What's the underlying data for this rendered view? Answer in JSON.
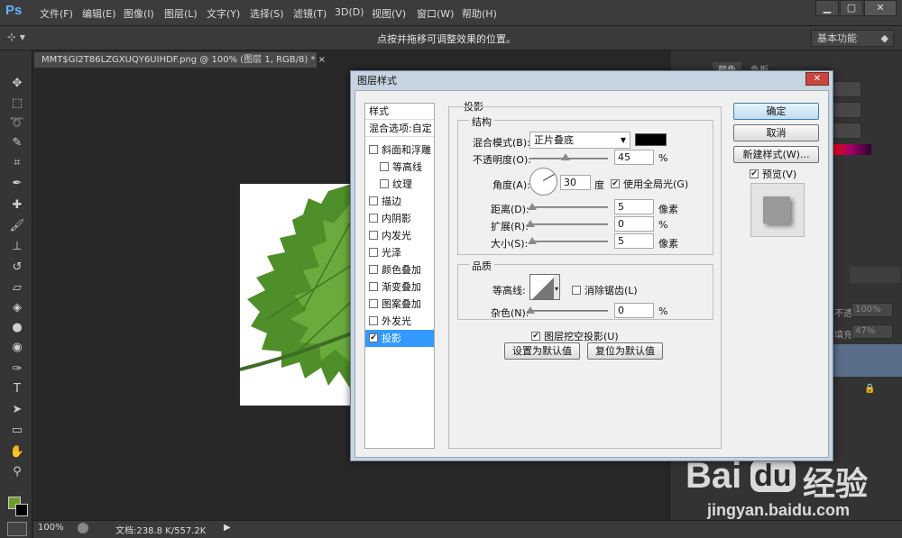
{
  "menubar": {
    "logo": "Ps",
    "items": [
      "文件(F)",
      "编辑(E)",
      "图像(I)",
      "图层(L)",
      "文字(Y)",
      "选择(S)",
      "滤镜(T)",
      "3D(D)",
      "视图(V)",
      "窗口(W)",
      "帮助(H)"
    ],
    "min": "▁",
    "max": "▢",
    "close": "✕"
  },
  "options": {
    "hint": "点按并拖移可调整效果的位置。",
    "workspace": "基本功能"
  },
  "doc": {
    "tab": "MMT$GI2T86LZGXUQY6UIHDF.png @ 100% (图层 1, RGB/8) *",
    "tab_close": "×"
  },
  "status": {
    "zoom": "100%",
    "info": "文档:238.8 K/557.2K"
  },
  "rpanel": {
    "tab1": "颜色",
    "tab2": "色板",
    "opacity_label": "不透明度:",
    "opacity": "100%",
    "fill_label": "填充:",
    "fill": "47%"
  },
  "dialog": {
    "title": "图层样式",
    "close": "✕",
    "styles_header": "样式",
    "blend_opts": "混合选项:自定",
    "styles": [
      {
        "label": "斜面和浮雕",
        "checked": false,
        "indent": false
      },
      {
        "label": "等高线",
        "checked": false,
        "indent": true
      },
      {
        "label": "纹理",
        "checked": false,
        "indent": true
      },
      {
        "label": "描边",
        "checked": false,
        "indent": false
      },
      {
        "label": "内阴影",
        "checked": false,
        "indent": false
      },
      {
        "label": "内发光",
        "checked": false,
        "indent": false
      },
      {
        "label": "光泽",
        "checked": false,
        "indent": false
      },
      {
        "label": "颜色叠加",
        "checked": false,
        "indent": false
      },
      {
        "label": "渐变叠加",
        "checked": false,
        "indent": false
      },
      {
        "label": "图案叠加",
        "checked": false,
        "indent": false
      },
      {
        "label": "外发光",
        "checked": false,
        "indent": false
      },
      {
        "label": "投影",
        "checked": true,
        "indent": false
      }
    ],
    "section_title": "投影",
    "structure": "结构",
    "blend_mode_label": "混合模式(B):",
    "blend_mode": "正片叠底",
    "shadow_color": "#000000",
    "opacity_label": "不透明度(O):",
    "opacity": "45",
    "opacity_unit": "%",
    "opacity_frac": 0.45,
    "angle_label": "角度(A):",
    "angle": "30",
    "angle_unit": "度",
    "global_light": "使用全局光(G)",
    "global_light_checked": true,
    "distance_label": "距离(D):",
    "distance": "5",
    "distance_unit": "像素",
    "distance_frac": 0.02,
    "spread_label": "扩展(R):",
    "spread": "0",
    "spread_unit": "%",
    "spread_frac": 0.0,
    "size_label": "大小(S):",
    "size": "5",
    "size_unit": "像素",
    "size_frac": 0.02,
    "quality": "品质",
    "contour_label": "等高线:",
    "antialias": "消除锯齿(L)",
    "antialias_checked": false,
    "noise_label": "杂色(N):",
    "noise": "0",
    "noise_unit": "%",
    "noise_frac": 0.0,
    "knockout": "图层挖空投影(U)",
    "knockout_checked": true,
    "set_default": "设置为默认值",
    "reset_default": "复位为默认值",
    "ok": "确定",
    "cancel": "取消",
    "new_style": "新建样式(W)...",
    "preview": "预览(V)",
    "preview_checked": true
  },
  "watermark": {
    "brand": "Bai",
    "brand2": "经验",
    "url": "jingyan.baidu.com",
    "paw": "du"
  },
  "colors": {
    "accent": "#3399ff",
    "leaf": "#4f8f2a",
    "fg_swatch": "#6a9d2c"
  }
}
